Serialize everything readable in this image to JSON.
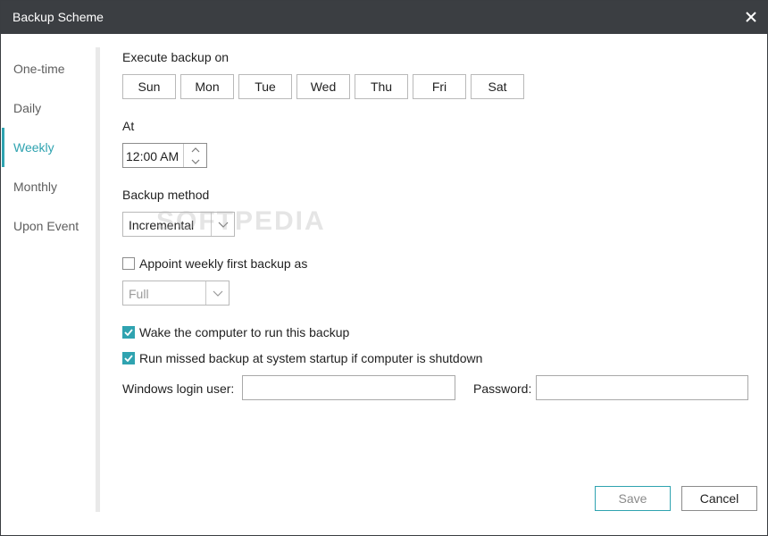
{
  "window": {
    "title": "Backup Scheme"
  },
  "sidebar": {
    "items": [
      {
        "label": "One-time"
      },
      {
        "label": "Daily"
      },
      {
        "label": "Weekly",
        "active": true
      },
      {
        "label": "Monthly"
      },
      {
        "label": "Upon Event"
      }
    ]
  },
  "schedule": {
    "execute_label": "Execute backup on",
    "days": [
      "Sun",
      "Mon",
      "Tue",
      "Wed",
      "Thu",
      "Fri",
      "Sat"
    ],
    "at_label": "At",
    "time_value": "12:00 AM"
  },
  "method": {
    "label": "Backup method",
    "selected": "Incremental",
    "appoint_label": "Appoint weekly first backup as",
    "appoint_checked": false,
    "appoint_selected": "Full"
  },
  "options": {
    "wake_label": "Wake the computer to run this backup",
    "wake_checked": true,
    "missed_label": "Run missed backup at system startup if computer is shutdown",
    "missed_checked": true
  },
  "login": {
    "user_label": "Windows login user:",
    "user_value": "",
    "password_label": "Password:",
    "password_value": ""
  },
  "actions": {
    "save_label": "Save",
    "cancel_label": "Cancel"
  },
  "watermark": "SOFTPEDIA",
  "colors": {
    "accent": "#2fa3b0",
    "titlebar": "#3b3e42"
  },
  "icons": {
    "close": "close-icon",
    "spin_up": "chevron-up-icon",
    "spin_down": "chevron-down-icon",
    "dropdown": "chevron-down-icon",
    "check": "check-icon"
  }
}
